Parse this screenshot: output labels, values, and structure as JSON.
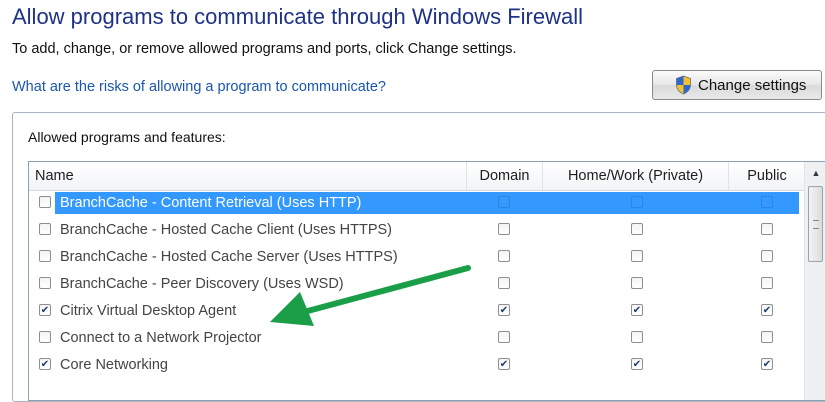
{
  "header": {
    "title": "Allow programs to communicate through Windows Firewall",
    "subtitle": "To add, change, or remove allowed programs and ports, click Change settings.",
    "risk_link": "What are the risks of allowing a program to communicate?",
    "change_settings_label": "Change settings"
  },
  "group": {
    "label": "Allowed programs and features:"
  },
  "table": {
    "columns": [
      "Name",
      "Domain",
      "Home/Work (Private)",
      "Public"
    ],
    "rows": [
      {
        "name": "BranchCache - Content Retrieval (Uses HTTP)",
        "enabled": false,
        "domain": false,
        "private": false,
        "public": false,
        "selected": true
      },
      {
        "name": "BranchCache - Hosted Cache Client (Uses HTTPS)",
        "enabled": false,
        "domain": false,
        "private": false,
        "public": false,
        "selected": false
      },
      {
        "name": "BranchCache - Hosted Cache Server (Uses HTTPS)",
        "enabled": false,
        "domain": false,
        "private": false,
        "public": false,
        "selected": false
      },
      {
        "name": "BranchCache - Peer Discovery (Uses WSD)",
        "enabled": false,
        "domain": false,
        "private": false,
        "public": false,
        "selected": false
      },
      {
        "name": "Citrix Virtual Desktop Agent",
        "enabled": true,
        "domain": true,
        "private": true,
        "public": true,
        "selected": false
      },
      {
        "name": "Connect to a Network Projector",
        "enabled": false,
        "domain": false,
        "private": false,
        "public": false,
        "selected": false
      },
      {
        "name": "Core Networking",
        "enabled": true,
        "domain": true,
        "private": true,
        "public": true,
        "selected": false
      }
    ]
  },
  "annotation": {
    "arrow_color": "#1a9e47"
  },
  "colors": {
    "title": "#1e3287",
    "link": "#1a56b0",
    "selection": "#3399ff"
  }
}
